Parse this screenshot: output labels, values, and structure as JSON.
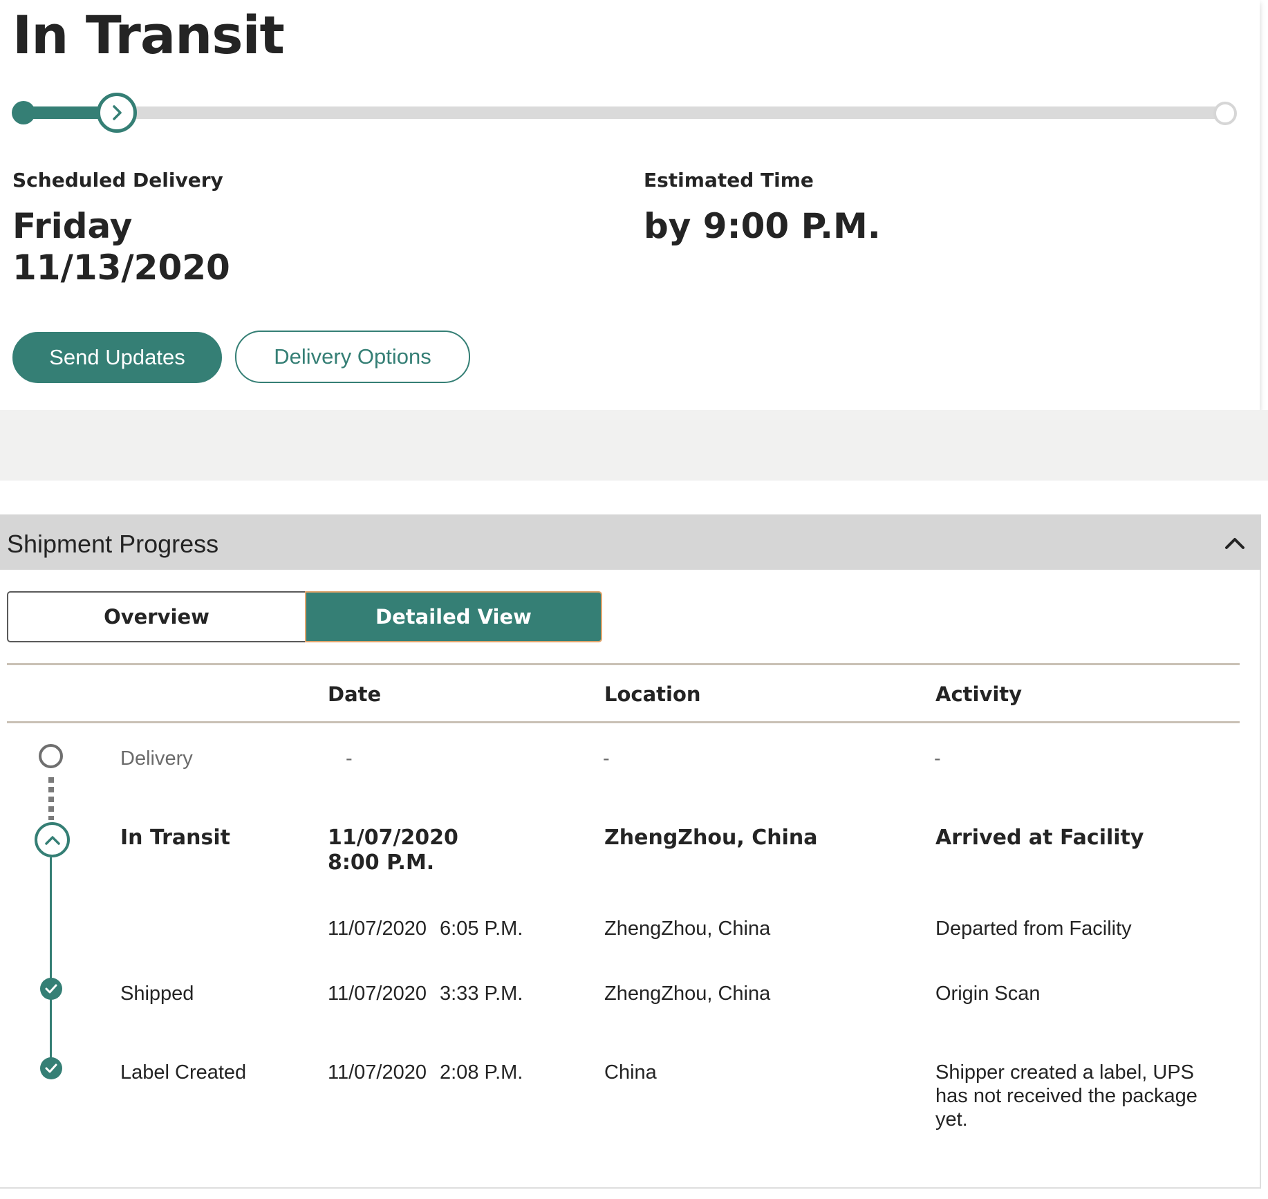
{
  "status": {
    "title": "In Transit",
    "progress_fraction": 0.08,
    "scheduled_label": "Scheduled Delivery",
    "scheduled_day": "Friday",
    "scheduled_date": "11/13/2020",
    "estimated_label": "Estimated Time",
    "estimated_value": "by 9:00 P.M.",
    "send_updates_label": "Send Updates",
    "delivery_options_label": "Delivery Options"
  },
  "shipment_progress": {
    "title": "Shipment Progress",
    "tabs": [
      {
        "label": "Overview",
        "selected": false
      },
      {
        "label": "Detailed View",
        "selected": true
      }
    ],
    "columns": {
      "date": "Date",
      "location": "Location",
      "activity": "Activity"
    },
    "rows": [
      {
        "milestone": "Delivery",
        "date": "-",
        "location": "-",
        "activity": "-"
      },
      {
        "milestone": "In Transit",
        "date": "11/07/2020",
        "time": "8:00 P.M.",
        "location": "ZhengZhou, China",
        "activity": "Arrived at Facility"
      },
      {
        "milestone": "",
        "date": "11/07/2020",
        "time": "6:05 P.M.",
        "location": "ZhengZhou, China",
        "activity": "Departed from Facility"
      },
      {
        "milestone": "Shipped",
        "date": "11/07/2020",
        "time": "3:33 P.M.",
        "location": "ZhengZhou, China",
        "activity": "Origin Scan"
      },
      {
        "milestone": "Label Created",
        "date": "11/07/2020",
        "time": "2:08 P.M.",
        "location": "China",
        "activity_lines": [
          "Shipper created a label, UPS",
          "has not received the package",
          "yet."
        ]
      }
    ]
  },
  "colors": {
    "accent": "#357f75",
    "track": "#dadada",
    "header_bg": "#d6d6d6",
    "band": "#f1f1f0",
    "tab_outline": "#e0a46c"
  },
  "icons": {
    "track_current": "chevron-right-icon",
    "collapse": "chevron-up-icon",
    "timeline_current": "chevron-up-icon",
    "timeline_done": "check-icon"
  }
}
